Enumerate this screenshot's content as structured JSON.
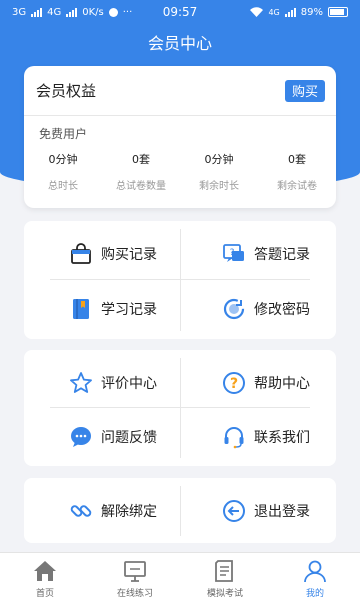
{
  "status": {
    "net1": "3G",
    "net2": "4G",
    "speed": "0K/s",
    "dots": "···",
    "time": "09:57",
    "net_right": "4G",
    "battery": "89%"
  },
  "header": {
    "title": "会员中心"
  },
  "membership": {
    "title": "会员权益",
    "buy_label": "购买",
    "user_type": "免费用户",
    "stats": [
      {
        "value": "0分钟",
        "label": "总时长"
      },
      {
        "value": "0套",
        "label": "总试卷数量"
      },
      {
        "value": "0分钟",
        "label": "剩余时长"
      },
      {
        "value": "0套",
        "label": "剩余试卷"
      }
    ]
  },
  "menu_groups": [
    {
      "items": [
        {
          "label": "购买记录",
          "icon": "shopping-bag-icon"
        },
        {
          "label": "答题记录",
          "icon": "answer-chat-icon"
        },
        {
          "label": "学习记录",
          "icon": "book-icon"
        },
        {
          "label": "修改密码",
          "icon": "refresh-password-icon"
        }
      ]
    },
    {
      "items": [
        {
          "label": "评价中心",
          "icon": "star-icon"
        },
        {
          "label": "帮助中心",
          "icon": "help-icon"
        },
        {
          "label": "问题反馈",
          "icon": "feedback-chat-icon"
        },
        {
          "label": "联系我们",
          "icon": "headset-icon"
        }
      ]
    },
    {
      "items": [
        {
          "label": "解除绑定",
          "icon": "unlink-icon"
        },
        {
          "label": "退出登录",
          "icon": "logout-icon"
        }
      ]
    }
  ],
  "tabbar": [
    {
      "label": "首页",
      "icon": "home-icon",
      "active": false
    },
    {
      "label": "在线练习",
      "icon": "monitor-icon",
      "active": false
    },
    {
      "label": "模拟考试",
      "icon": "exam-paper-icon",
      "active": false
    },
    {
      "label": "我的",
      "icon": "user-icon",
      "active": true
    }
  ],
  "colors": {
    "primary": "#3784e8",
    "orange": "#f7a21b",
    "background": "#f2f3f7"
  }
}
